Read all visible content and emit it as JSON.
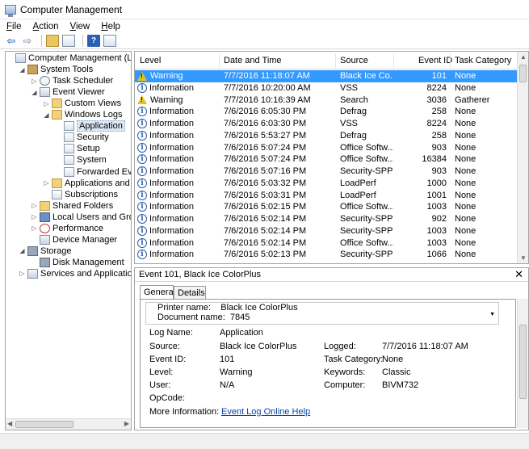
{
  "window": {
    "title": "Computer Management"
  },
  "menu": [
    {
      "label": "File",
      "accel": "F",
      "rest": "ile"
    },
    {
      "label": "Action",
      "accel": "A",
      "rest": "ction"
    },
    {
      "label": "View",
      "accel": "V",
      "rest": "iew"
    },
    {
      "label": "Help",
      "accel": "H",
      "rest": "elp"
    }
  ],
  "tree": [
    {
      "label": "Computer Management (Local",
      "arrow": "",
      "icon": "computer-icon",
      "indent": 0
    },
    {
      "label": "System Tools",
      "arrow": "◢",
      "icon": "tools-icon",
      "indent": 1
    },
    {
      "label": "Task Scheduler",
      "arrow": "▷",
      "icon": "clock-icon",
      "indent": 2
    },
    {
      "label": "Event Viewer",
      "arrow": "◢",
      "icon": "event-viewer-icon",
      "indent": 2
    },
    {
      "label": "Custom Views",
      "arrow": "▷",
      "icon": "folder-icon",
      "indent": 3
    },
    {
      "label": "Windows Logs",
      "arrow": "◢",
      "icon": "folder-icon",
      "indent": 3
    },
    {
      "label": "Application",
      "arrow": "",
      "icon": "log-icon",
      "indent": 4,
      "selected": true
    },
    {
      "label": "Security",
      "arrow": "",
      "icon": "log-icon",
      "indent": 4
    },
    {
      "label": "Setup",
      "arrow": "",
      "icon": "log-icon",
      "indent": 4
    },
    {
      "label": "System",
      "arrow": "",
      "icon": "log-icon",
      "indent": 4
    },
    {
      "label": "Forwarded Event",
      "arrow": "",
      "icon": "log-icon",
      "indent": 4
    },
    {
      "label": "Applications and Se",
      "arrow": "▷",
      "icon": "folder-icon",
      "indent": 3
    },
    {
      "label": "Subscriptions",
      "arrow": "",
      "icon": "subscriptions-icon",
      "indent": 3
    },
    {
      "label": "Shared Folders",
      "arrow": "▷",
      "icon": "shared-folder-icon",
      "indent": 2
    },
    {
      "label": "Local Users and Groups",
      "arrow": "▷",
      "icon": "users-icon",
      "indent": 2
    },
    {
      "label": "Performance",
      "arrow": "▷",
      "icon": "performance-icon",
      "indent": 2
    },
    {
      "label": "Device Manager",
      "arrow": "",
      "icon": "device-manager-icon",
      "indent": 2
    },
    {
      "label": "Storage",
      "arrow": "◢",
      "icon": "storage-icon",
      "indent": 1
    },
    {
      "label": "Disk Management",
      "arrow": "",
      "icon": "disk-icon",
      "indent": 2
    },
    {
      "label": "Services and Applications",
      "arrow": "▷",
      "icon": "services-icon",
      "indent": 1
    }
  ],
  "events": {
    "columns": [
      "Level",
      "Date and Time",
      "Source",
      "Event ID",
      "Task Category"
    ],
    "rows": [
      {
        "level": "Warning",
        "datetime": "7/7/2016 11:18:07 AM",
        "source": "Black Ice Co...",
        "id": "101",
        "category": "None",
        "selected": true
      },
      {
        "level": "Information",
        "datetime": "7/7/2016 10:20:00 AM",
        "source": "VSS",
        "id": "8224",
        "category": "None"
      },
      {
        "level": "Warning",
        "datetime": "7/7/2016 10:16:39 AM",
        "source": "Search",
        "id": "3036",
        "category": "Gatherer"
      },
      {
        "level": "Information",
        "datetime": "7/6/2016 6:05:30 PM",
        "source": "Defrag",
        "id": "258",
        "category": "None"
      },
      {
        "level": "Information",
        "datetime": "7/6/2016 6:03:30 PM",
        "source": "VSS",
        "id": "8224",
        "category": "None"
      },
      {
        "level": "Information",
        "datetime": "7/6/2016 5:53:27 PM",
        "source": "Defrag",
        "id": "258",
        "category": "None"
      },
      {
        "level": "Information",
        "datetime": "7/6/2016 5:07:24 PM",
        "source": "Office Softw...",
        "id": "903",
        "category": "None"
      },
      {
        "level": "Information",
        "datetime": "7/6/2016 5:07:24 PM",
        "source": "Office Softw...",
        "id": "16384",
        "category": "None"
      },
      {
        "level": "Information",
        "datetime": "7/6/2016 5:07:16 PM",
        "source": "Security-SPP",
        "id": "903",
        "category": "None"
      },
      {
        "level": "Information",
        "datetime": "7/6/2016 5:03:32 PM",
        "source": "LoadPerf",
        "id": "1000",
        "category": "None"
      },
      {
        "level": "Information",
        "datetime": "7/6/2016 5:03:31 PM",
        "source": "LoadPerf",
        "id": "1001",
        "category": "None"
      },
      {
        "level": "Information",
        "datetime": "7/6/2016 5:02:15 PM",
        "source": "Office Softw...",
        "id": "1003",
        "category": "None"
      },
      {
        "level": "Information",
        "datetime": "7/6/2016 5:02:14 PM",
        "source": "Security-SPP",
        "id": "902",
        "category": "None"
      },
      {
        "level": "Information",
        "datetime": "7/6/2016 5:02:14 PM",
        "source": "Security-SPP",
        "id": "1003",
        "category": "None"
      },
      {
        "level": "Information",
        "datetime": "7/6/2016 5:02:14 PM",
        "source": "Office Softw...",
        "id": "1003",
        "category": "None"
      },
      {
        "level": "Information",
        "datetime": "7/6/2016 5:02:13 PM",
        "source": "Security-SPP",
        "id": "1066",
        "category": "None"
      }
    ]
  },
  "detail": {
    "title": "Event 101, Black Ice ColorPlus",
    "tabs": [
      "General",
      "Details"
    ],
    "message_line1": "Printer name:    Black Ice ColorPlus",
    "message_line2": "Document name:  7845",
    "fields": {
      "log_name_label": "Log Name:",
      "log_name": "Application",
      "source_label": "Source:",
      "source": "Black Ice ColorPlus",
      "event_id_label": "Event ID:",
      "event_id": "101",
      "level_label": "Level:",
      "level": "Warning",
      "user_label": "User:",
      "user": "N/A",
      "opcode_label": "OpCode:",
      "more_info_label": "More Information:",
      "more_info_link": "Event Log Online Help",
      "logged_label": "Logged:",
      "logged": "7/7/2016 11:18:07 AM",
      "task_category_label": "Task Category:",
      "task_category": "None",
      "keywords_label": "Keywords:",
      "keywords": "Classic",
      "computer_label": "Computer:",
      "computer": "BIVM732"
    }
  }
}
